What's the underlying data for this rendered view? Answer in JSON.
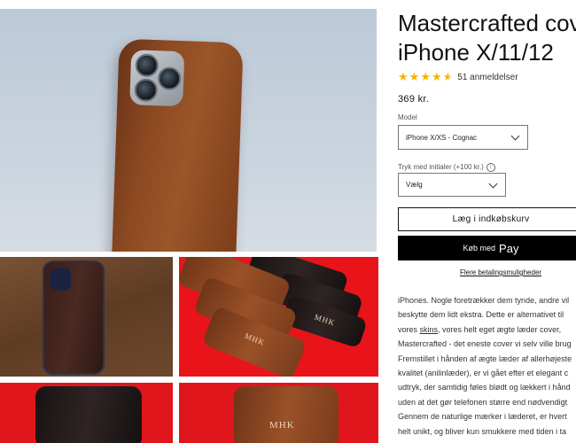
{
  "product": {
    "title_line1": "Mastercrafted cover",
    "title_line2": "iPhone X/11/12",
    "rating": 4.5,
    "reviews": "51 anmeldelser",
    "price": "369 kr."
  },
  "model": {
    "label": "Model",
    "selected": "iPhone X/XS - Cognac"
  },
  "initials": {
    "label": "Tryk med initialer (+100 kr.)",
    "info_glyph": "i",
    "selected": "Vælg"
  },
  "buttons": {
    "add_to_cart": "Læg i indkøbskurv",
    "buy_with": "Køb med",
    "apple_pay": "Pay",
    "apple_glyph": "",
    "more_payment": "Flere betalingsmuligheder"
  },
  "description": {
    "line1": "iPhones. Nogle foretrækker dem tynde, andre vil",
    "line2": "beskytte dem lidt ekstra. Dette er alternativet til",
    "line3_pre": "vores ",
    "line3_link": "skins",
    "line3_post": ", vores helt eget ægte læder cover,",
    "line4": "Mastercrafted - det eneste cover vi selv ville brug",
    "line5": "Fremstillet i hånden af ægte læder af allerhøjeste",
    "line6": "kvalitet (anilinlæder), er vi gået efter et elegant c",
    "line7": "udtryk, der samtidig føles blødt og lækkert i hånd",
    "line8": "uden at det gør telefonen større end nødvendigt",
    "line9": "Gennem de naturlige mærker i læderet, er hvert",
    "line10": "helt unikt, og bliver kun smukkere med tiden i ta"
  },
  "gallery": {
    "monogram": "MHK"
  },
  "colors": {
    "star": "#f4b400",
    "button_dark": "#000000",
    "red_backdrop": "#e8141a",
    "cognac": "#8d4a22"
  }
}
